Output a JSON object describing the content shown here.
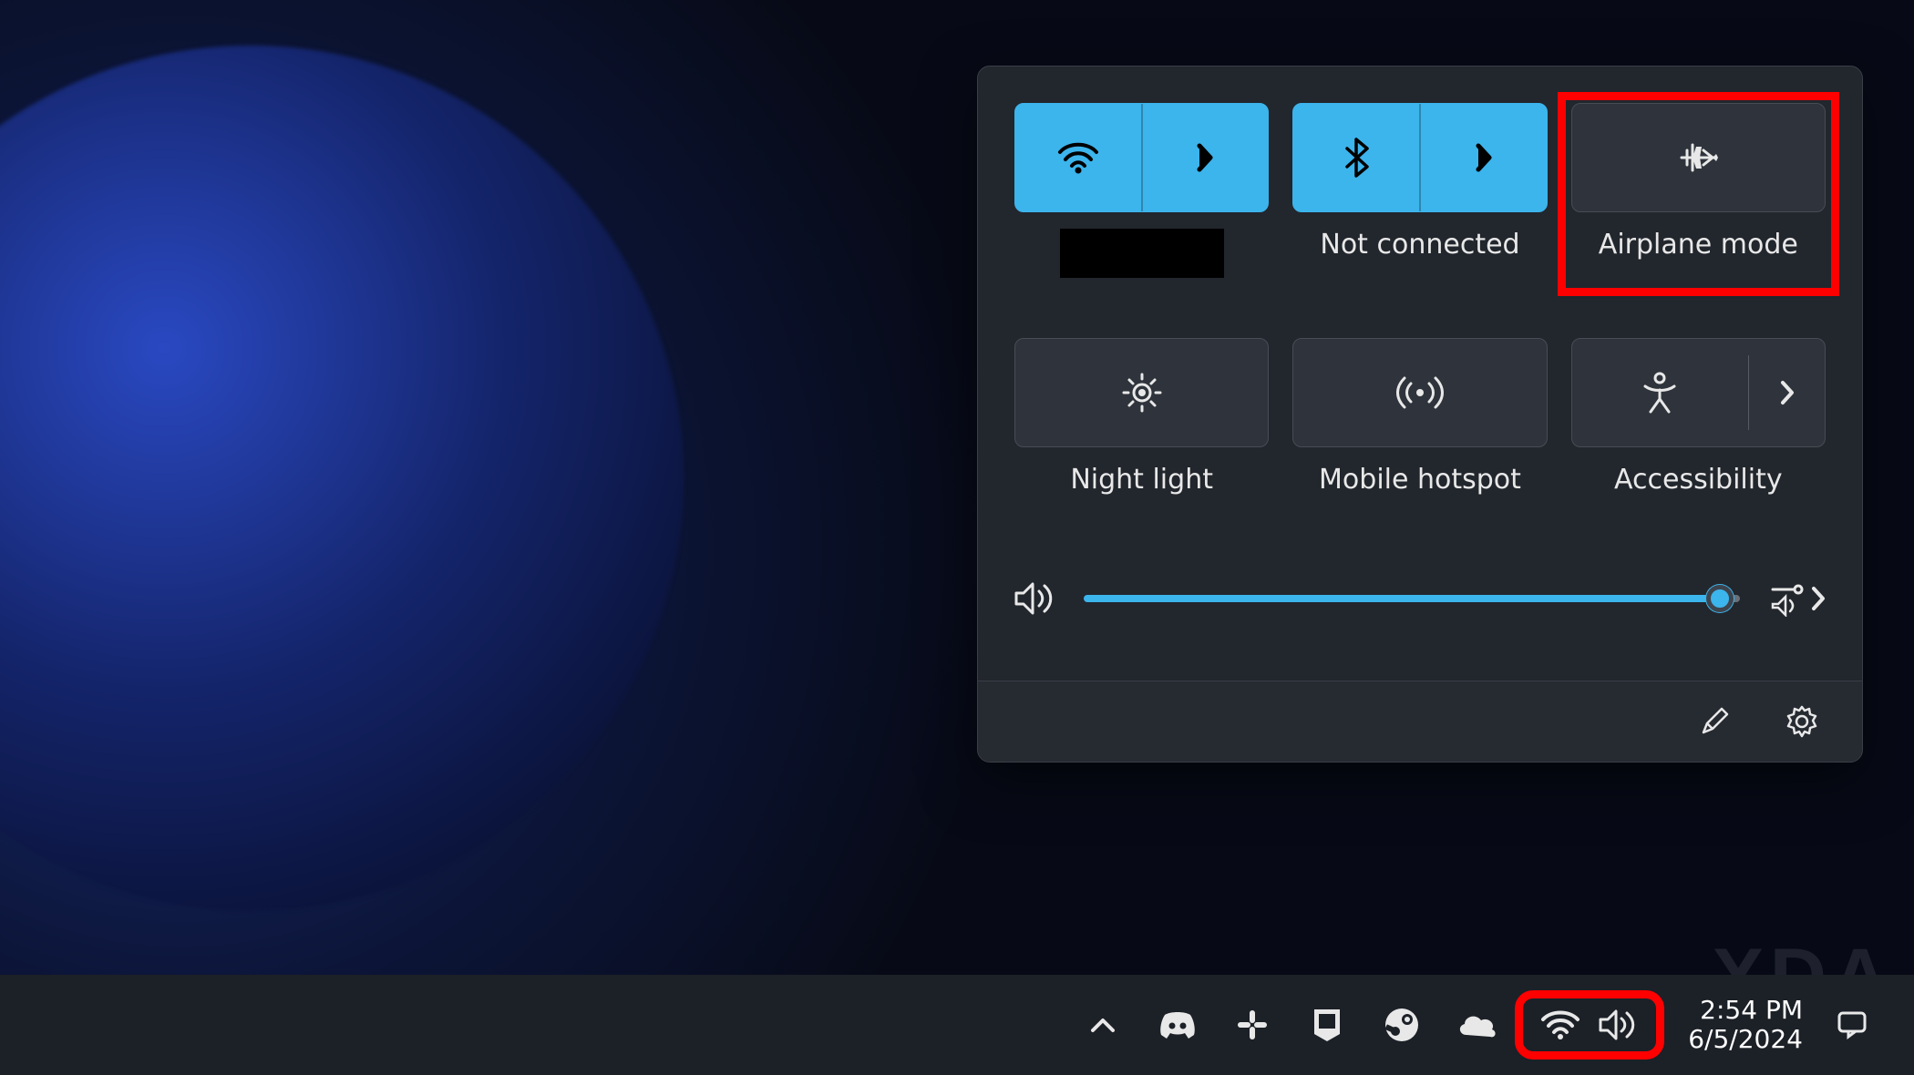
{
  "flyout": {
    "tiles": [
      {
        "id": "wifi",
        "label": "",
        "redacted": true,
        "active": true,
        "split": true,
        "icon": "wifi"
      },
      {
        "id": "bluetooth",
        "label": "Not connected",
        "redacted": false,
        "active": true,
        "split": true,
        "icon": "bluetooth"
      },
      {
        "id": "airplane",
        "label": "Airplane mode",
        "redacted": false,
        "active": false,
        "split": false,
        "icon": "airplane",
        "highlight": true
      },
      {
        "id": "night-light",
        "label": "Night light",
        "redacted": false,
        "active": false,
        "split": false,
        "icon": "night"
      },
      {
        "id": "mobile-hotspot",
        "label": "Mobile hotspot",
        "redacted": false,
        "active": false,
        "split": false,
        "icon": "hotspot"
      },
      {
        "id": "accessibility",
        "label": "Accessibility",
        "redacted": false,
        "active": false,
        "split": true,
        "icon": "accessibility"
      }
    ],
    "volume": {
      "percent": 97
    },
    "footer": {
      "edit": "Edit",
      "settings": "Settings"
    }
  },
  "taskbar": {
    "tray_icons": [
      "chevron-up",
      "discord",
      "slack",
      "epic-games",
      "steam",
      "onedrive"
    ],
    "system_icons": [
      "wifi",
      "volume"
    ],
    "clock": {
      "time": "2:54 PM",
      "date": "6/5/2024"
    }
  },
  "watermark": "XDA"
}
